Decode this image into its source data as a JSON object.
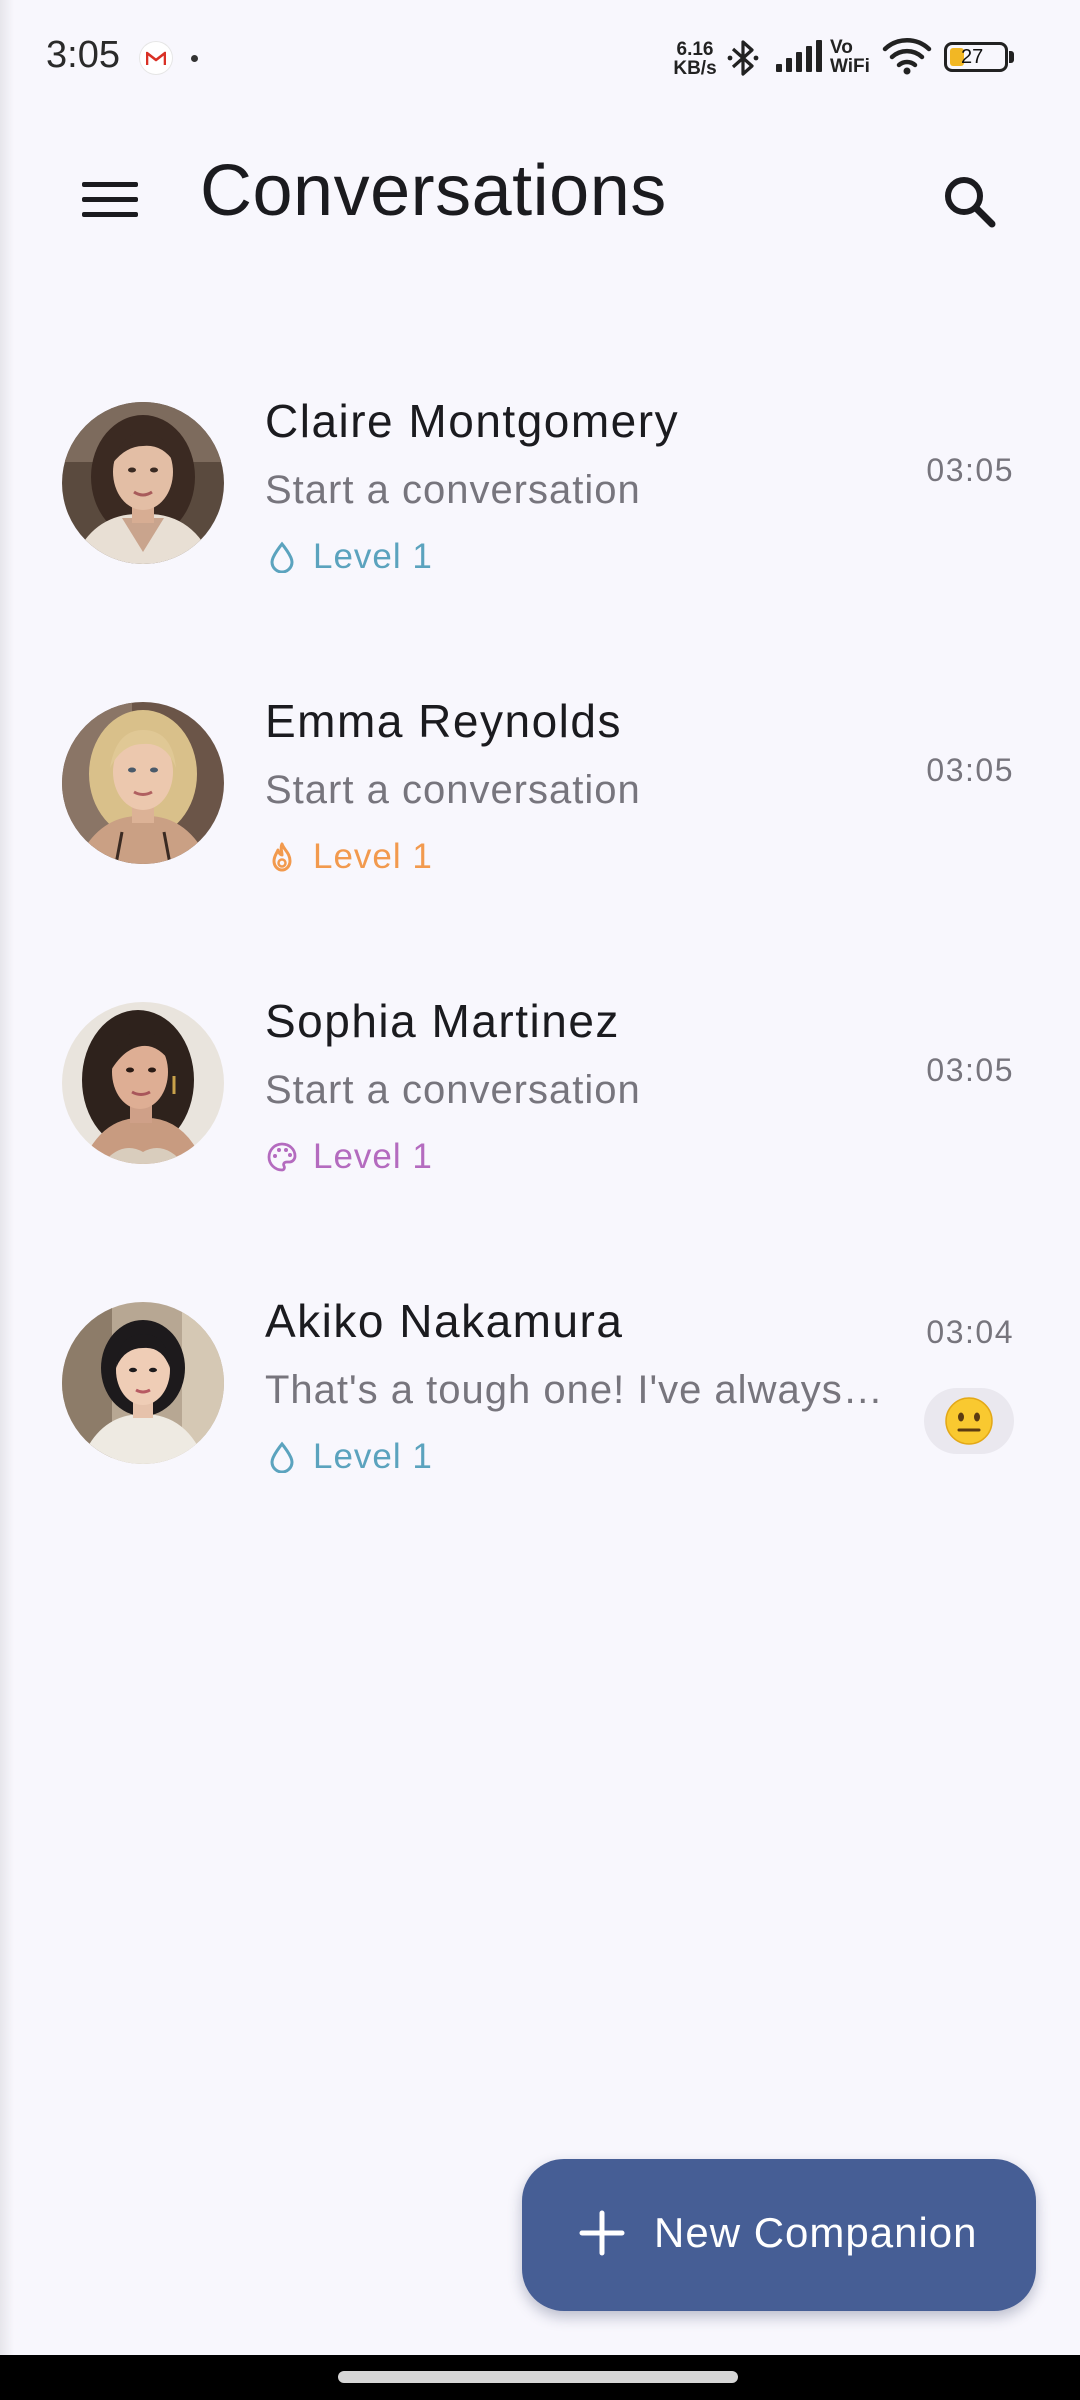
{
  "status_bar": {
    "time": "3:05",
    "net_speed_value": "6.16",
    "net_speed_unit": "KB/s",
    "vo_label": "Vo",
    "wifi_label": "WiFi",
    "battery": "27"
  },
  "app_bar": {
    "title": "Conversations",
    "menu_icon": "hamburger-menu-icon",
    "search_icon": "search-icon"
  },
  "conversations": [
    {
      "name": "Claire Montgomery",
      "preview": "Start a conversation",
      "level": "Level 1",
      "level_icon": "water-drop-icon",
      "level_color": "#5ba3be",
      "time": "03:05"
    },
    {
      "name": "Emma Reynolds",
      "preview": "Start a conversation",
      "level": "Level 1",
      "level_icon": "flame-icon",
      "level_color": "#f29a4e",
      "time": "03:05"
    },
    {
      "name": "Sophia Martinez",
      "preview": "Start a conversation",
      "level": "Level 1",
      "level_icon": "palette-icon",
      "level_color": "#b46bbf",
      "time": "03:05"
    },
    {
      "name": "Akiko Nakamura",
      "preview": "That's a tough one! I've always been fascinated by the idea",
      "level": "Level 1",
      "level_icon": "water-drop-icon",
      "level_color": "#5ba3be",
      "time": "03:04",
      "mood": "😐"
    }
  ],
  "fab": {
    "label": "New Companion",
    "icon": "plus-icon",
    "color": "#465e95"
  }
}
